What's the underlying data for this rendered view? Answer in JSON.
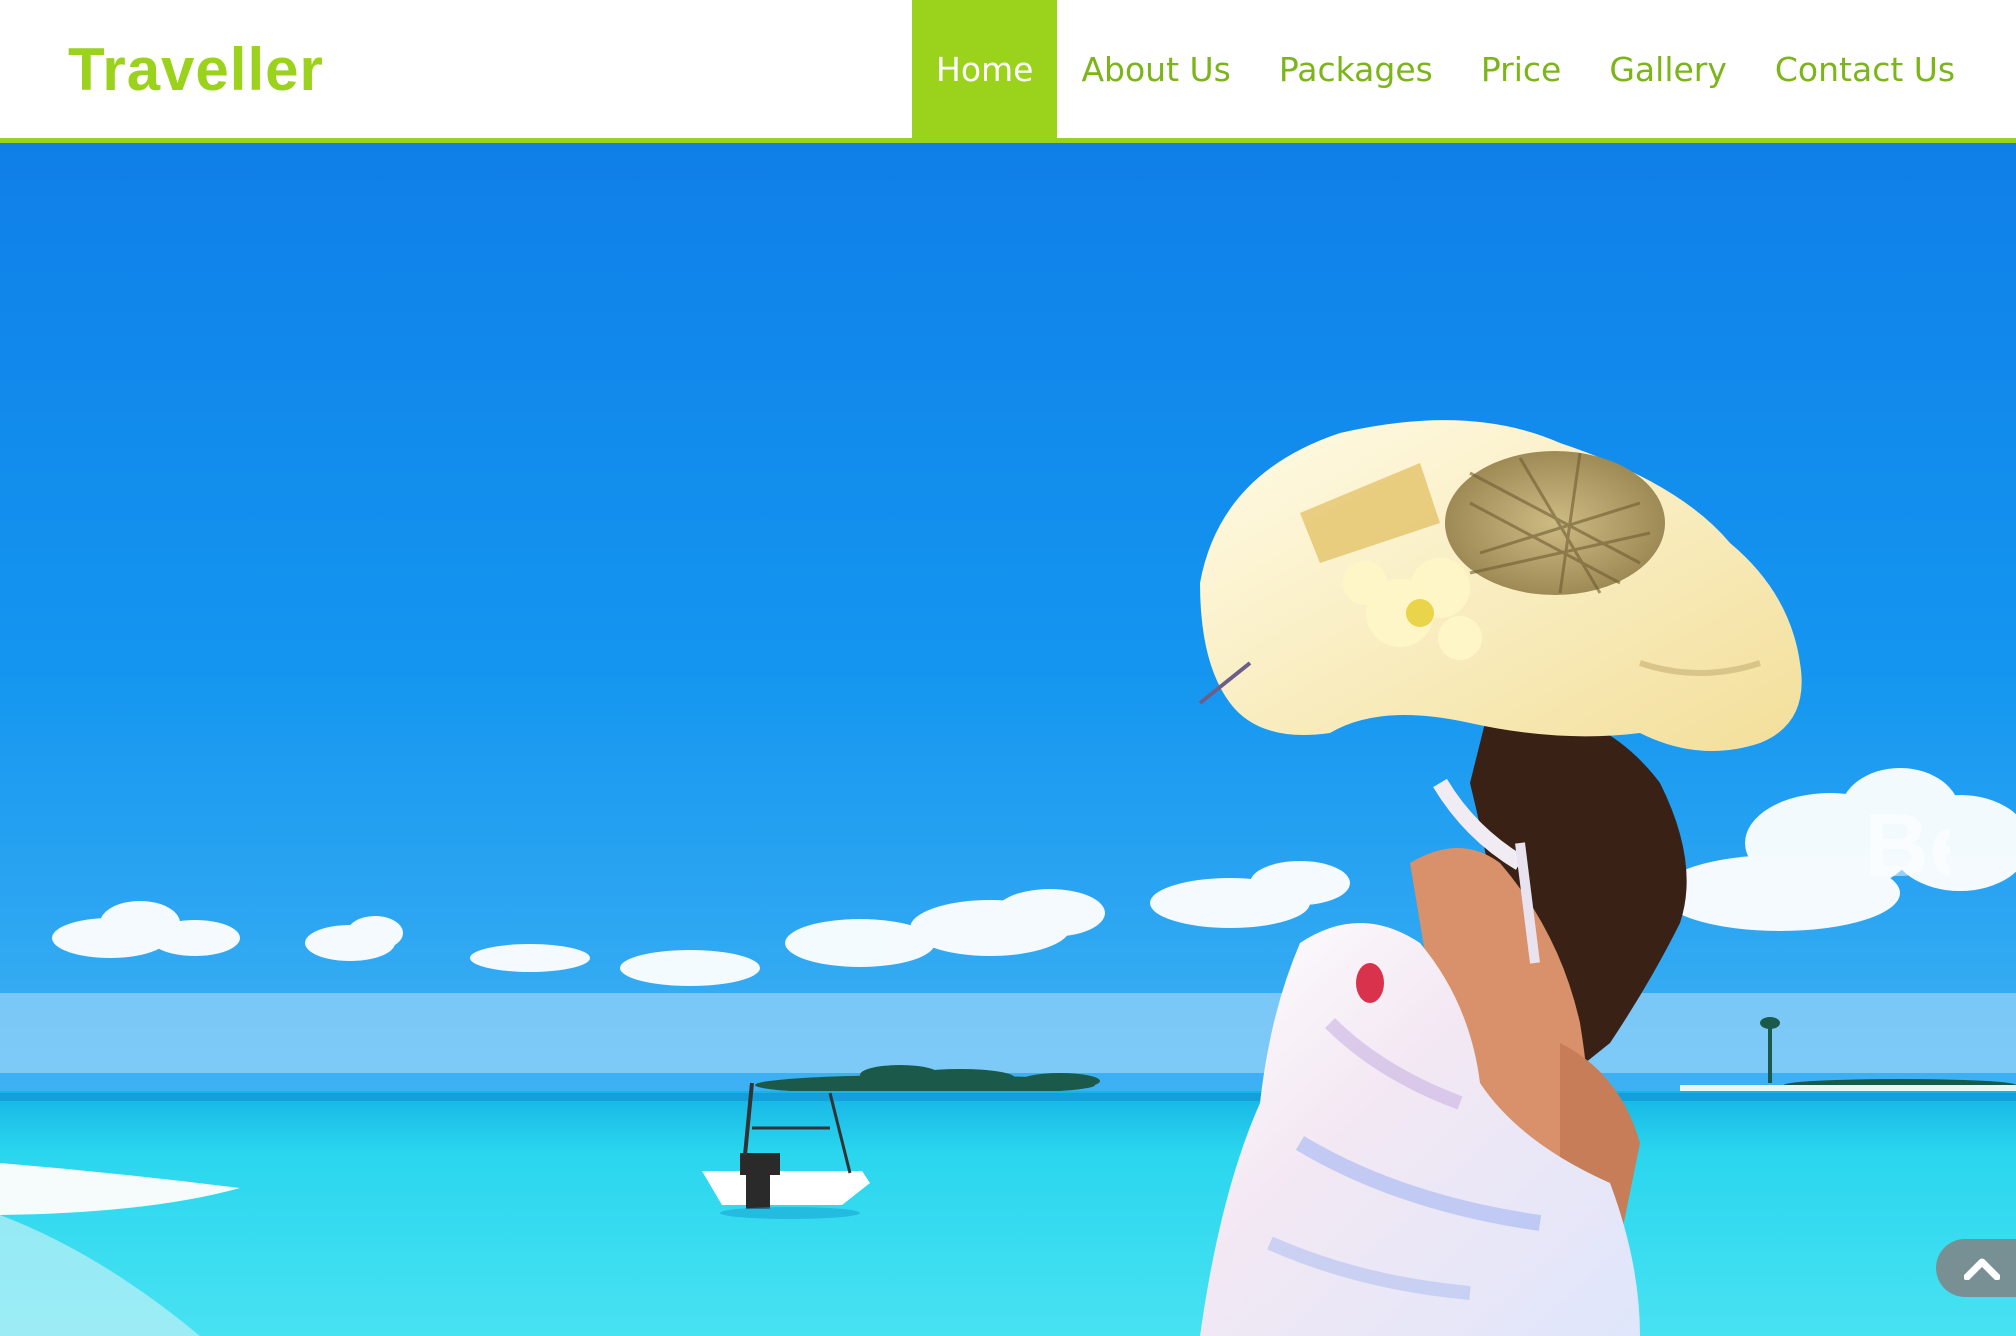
{
  "header": {
    "brand": "Traveller",
    "nav": [
      {
        "label": "Home",
        "active": true
      },
      {
        "label": "About Us",
        "active": false
      },
      {
        "label": "Packages",
        "active": false
      },
      {
        "label": "Price",
        "active": false
      },
      {
        "label": "Gallery",
        "active": false
      },
      {
        "label": "Contact Us",
        "active": false
      }
    ]
  },
  "hero": {
    "caption_partial": "Be"
  },
  "scroll_top": {
    "icon": "chevron-up-icon"
  },
  "colors": {
    "accent": "#9bd21c",
    "nav_text": "#7cb518",
    "sky_top": "#0f7fe8",
    "sea": "#2ad6ee",
    "scroll_button": "#828282"
  }
}
